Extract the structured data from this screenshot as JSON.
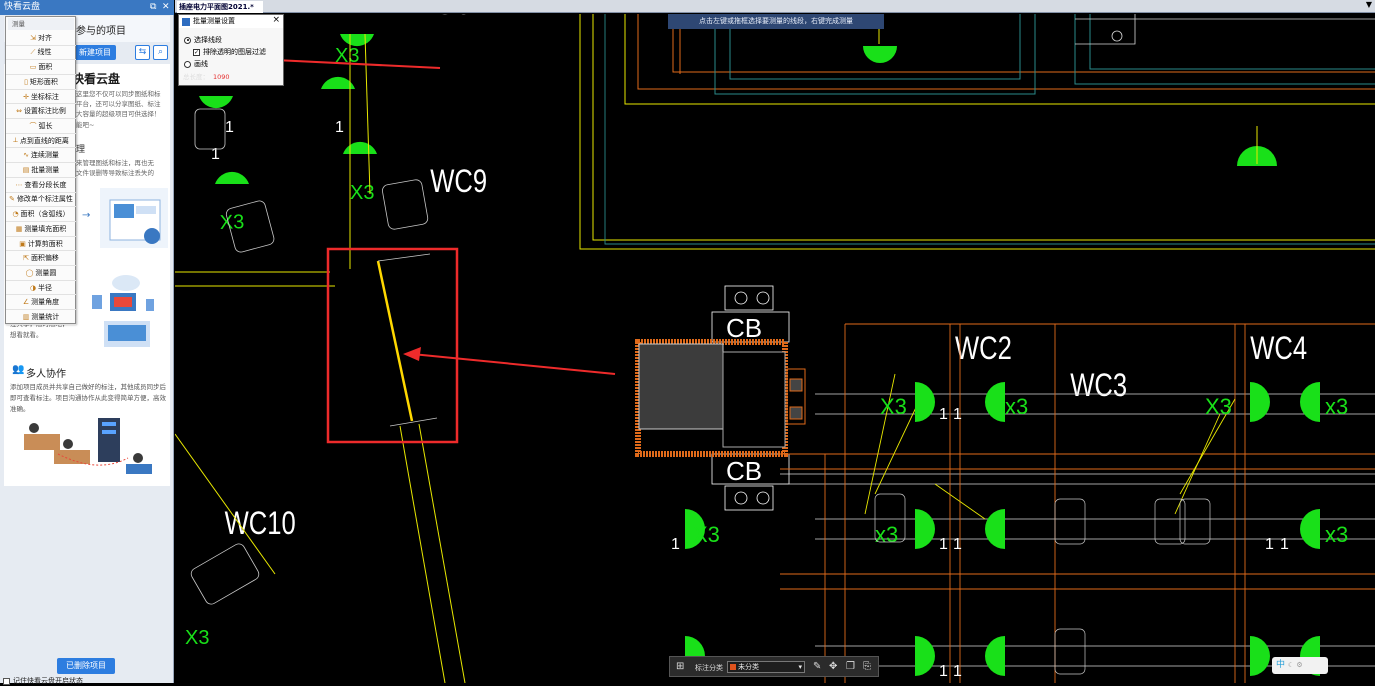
{
  "window": {
    "title": "快看云盘"
  },
  "left_panel": {
    "header_title": "我参与的项目",
    "new_project_label": "新建项目",
    "brand_title": "快看云盘",
    "brand_desc": [
      "这里您不仅可以同步图纸和标",
      "平台，还可以分享图纸、标注",
      "大容量的超级项目可供选择！",
      "能吧~"
    ],
    "section2_title": "理",
    "section2_desc": [
      "来管理图纸和标注，再也无",
      "文件误删等导致标注丢失的"
    ],
    "share_text": [
      "注共享，随时随地，",
      "想看就看。"
    ],
    "collab_title": "多人协作",
    "collab_text": "添加项目成员并共享自己做好的标注，其他成员同步后即可查看标注。项目沟通协作从此变得简单方便，高效准确。",
    "deleted_projects_label": "已删除项目",
    "remember_label": "记住快看云盘开启状态"
  },
  "measure_menu": {
    "header": "测量",
    "items": [
      {
        "label": "对齐",
        "icon": "align-icon"
      },
      {
        "label": "线性",
        "icon": "linear-icon"
      },
      {
        "label": "面积",
        "icon": "area-icon"
      },
      {
        "label": "矩形面积",
        "icon": "rect-area-icon"
      },
      {
        "label": "坐标标注",
        "icon": "coordinate-icon"
      },
      {
        "label": "设置标注比例",
        "icon": "scale-icon"
      },
      {
        "label": "弧长",
        "icon": "arc-length-icon"
      },
      {
        "label": "点到直线的距离",
        "icon": "point-line-icon"
      },
      {
        "label": "连续测量",
        "icon": "continuous-icon"
      },
      {
        "label": "批量测量",
        "icon": "batch-icon"
      },
      {
        "label": "查看分段长度",
        "icon": "segment-icon"
      },
      {
        "label": "修改单个标注属性",
        "icon": "edit-attr-icon"
      },
      {
        "label": "面积（含弧线）",
        "icon": "arc-area-icon"
      },
      {
        "label": "测量填充面积",
        "icon": "fill-area-icon"
      },
      {
        "label": "计算剪面积",
        "icon": "cut-area-icon"
      },
      {
        "label": "面积偏移",
        "icon": "offset-icon"
      },
      {
        "label": "测量圆",
        "icon": "circle-icon"
      },
      {
        "label": "半径",
        "icon": "radius-icon"
      },
      {
        "label": "测量角度",
        "icon": "angle-icon"
      },
      {
        "label": "测量统计",
        "icon": "stats-icon"
      }
    ]
  },
  "tab": {
    "label": "插座电力平面图2021.*",
    "close": "×"
  },
  "dialog": {
    "title": "批量测量设置",
    "option_select_line": "选择线段",
    "option_exclude_hidden": "排除透明的图层过滤",
    "option_polyline": "画线",
    "total_label": "总长度：",
    "total_value": "1090"
  },
  "hint": "点击左键或拖框选择要测量的线段，右键完成测量",
  "drawing": {
    "labels": [
      "WC9",
      "WC10",
      "WC2",
      "WC3",
      "WC4",
      "CB",
      "CB",
      "X3",
      "1"
    ]
  },
  "bottom_toolbar": {
    "label": "标注分类",
    "category": "未分类",
    "category_color": "#e0531d"
  },
  "ime": {
    "text": "中"
  }
}
